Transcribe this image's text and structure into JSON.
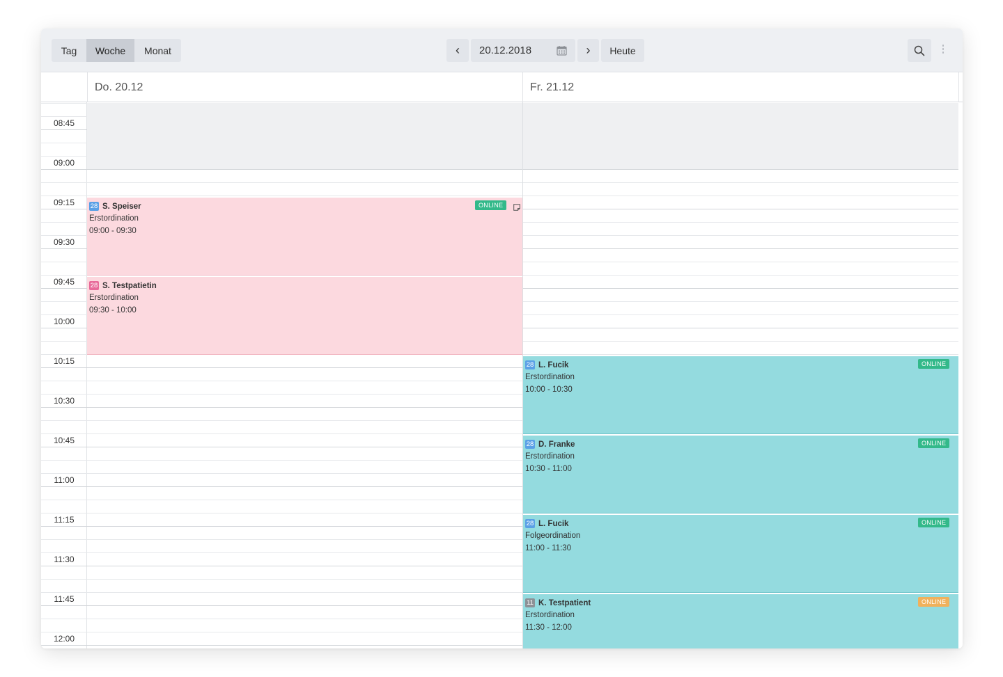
{
  "toolbar": {
    "views": [
      {
        "label": "Tag",
        "active": false
      },
      {
        "label": "Woche",
        "active": true
      },
      {
        "label": "Monat",
        "active": false
      }
    ],
    "prev_glyph": "‹",
    "next_glyph": "›",
    "date_value": "20.12.2018",
    "today_label": "Heute",
    "icons": {
      "calendar": "calendar-icon",
      "search": "search-icon",
      "menu": "more-vertical-icon"
    }
  },
  "columns": [
    {
      "label": "Do. 20.12"
    },
    {
      "label": "Fr. 21.12"
    }
  ],
  "time_labels": [
    "08:45",
    "09:00",
    "09:15",
    "09:30",
    "09:45",
    "10:00",
    "10:15",
    "10:30",
    "10:45",
    "11:00",
    "11:15",
    "11:30",
    "11:45",
    "12:00"
  ],
  "events": [
    {
      "badge": "28",
      "badge_color": "#5aa0e6",
      "name": "S. Speiser",
      "type": "Erstordination",
      "time": "09:00 - 09:30",
      "tag": "ONLINE",
      "tag_color": "#33b98a",
      "has_note": true,
      "color": "pink"
    },
    {
      "badge": "28",
      "badge_color": "#e86a9a",
      "name": "S. Testpatietin",
      "type": "Erstordination",
      "time": "09:30 - 10:00",
      "tag": "",
      "tag_color": "",
      "has_note": false,
      "color": "pink"
    },
    {
      "badge": "28",
      "badge_color": "#5aa0e6",
      "name": "L. Fucik",
      "type": "Erstordination",
      "time": "10:00 - 10:30",
      "tag": "ONLINE",
      "tag_color": "#33b98a",
      "has_note": false,
      "color": "teal"
    },
    {
      "badge": "28",
      "badge_color": "#5aa0e6",
      "name": "D. Franke",
      "type": "Erstordination",
      "time": "10:30 - 11:00",
      "tag": "ONLINE",
      "tag_color": "#33b98a",
      "has_note": false,
      "color": "teal"
    },
    {
      "badge": "28",
      "badge_color": "#5aa0e6",
      "name": "L. Fucik",
      "type": "Folgeordination",
      "time": "11:00 - 11:30",
      "tag": "ONLINE",
      "tag_color": "#33b98a",
      "has_note": false,
      "color": "teal"
    },
    {
      "badge": "11",
      "badge_color": "#8d9196",
      "name": "K. Testpatient",
      "type": "Erstordination",
      "time": "11:30 - 12:00",
      "tag": "ONLINE",
      "tag_color": "#f0b15c",
      "has_note": false,
      "color": "teal"
    }
  ]
}
